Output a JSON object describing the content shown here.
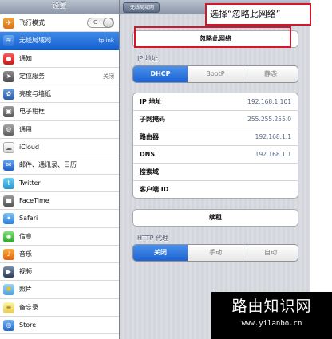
{
  "left_panel": {
    "title": "设置",
    "items": [
      {
        "label": "飞行模式",
        "icon": "airplane-icon",
        "toggle": "O"
      },
      {
        "label": "无线局域网",
        "icon": "wifi-icon",
        "value": "tplink",
        "selected": true
      },
      {
        "label": "通知",
        "icon": "notification-icon"
      },
      {
        "label": "定位服务",
        "icon": "location-icon",
        "value": "关闭"
      },
      {
        "label": "亮度与墙纸",
        "icon": "flower-icon"
      },
      {
        "label": "电子相框",
        "icon": "picture-frame-icon"
      },
      {
        "label": "通用",
        "icon": "gear-icon"
      },
      {
        "label": "iCloud",
        "icon": "cloud-icon"
      },
      {
        "label": "邮件、通讯录、日历",
        "icon": "mail-icon"
      },
      {
        "label": "Twitter",
        "icon": "twitter-icon"
      },
      {
        "label": "FaceTime",
        "icon": "video-camera-icon"
      },
      {
        "label": "Safari",
        "icon": "compass-icon"
      },
      {
        "label": "信息",
        "icon": "message-icon"
      },
      {
        "label": "音乐",
        "icon": "music-icon"
      },
      {
        "label": "视频",
        "icon": "film-icon"
      },
      {
        "label": "照片",
        "icon": "sunflower-icon"
      },
      {
        "label": "备忘录",
        "icon": "notes-icon"
      },
      {
        "label": "Store",
        "icon": "store-icon"
      }
    ]
  },
  "detail": {
    "back_label": "无线局域网",
    "forget_network_label": "忽略此网络",
    "ip_section_label": "IP 地址",
    "ip_modes": [
      {
        "label": "DHCP",
        "selected": true
      },
      {
        "label": "BootP",
        "selected": false
      },
      {
        "label": "静态",
        "selected": false
      }
    ],
    "ip_rows": [
      {
        "key": "IP 地址",
        "value": "192.168.1.101"
      },
      {
        "key": "子网掩码",
        "value": "255.255.255.0"
      },
      {
        "key": "路由器",
        "value": "192.168.1.1"
      },
      {
        "key": "DNS",
        "value": "192.168.1.1"
      },
      {
        "key": "搜索域",
        "value": ""
      },
      {
        "key": "客户端 ID",
        "value": ""
      }
    ],
    "renew_label": "续租",
    "proxy_section_label": "HTTP 代理",
    "proxy_modes": [
      {
        "label": "关闭",
        "selected": true
      },
      {
        "label": "手动",
        "selected": false
      },
      {
        "label": "自动",
        "selected": false
      }
    ]
  },
  "callout": {
    "text": "选择“忽略此网络”"
  },
  "watermark": {
    "title": "路由知识网",
    "url": "www.yilanbo.cn"
  },
  "colors": {
    "accent": "#1c63d4",
    "highlight": "#d4162b"
  }
}
